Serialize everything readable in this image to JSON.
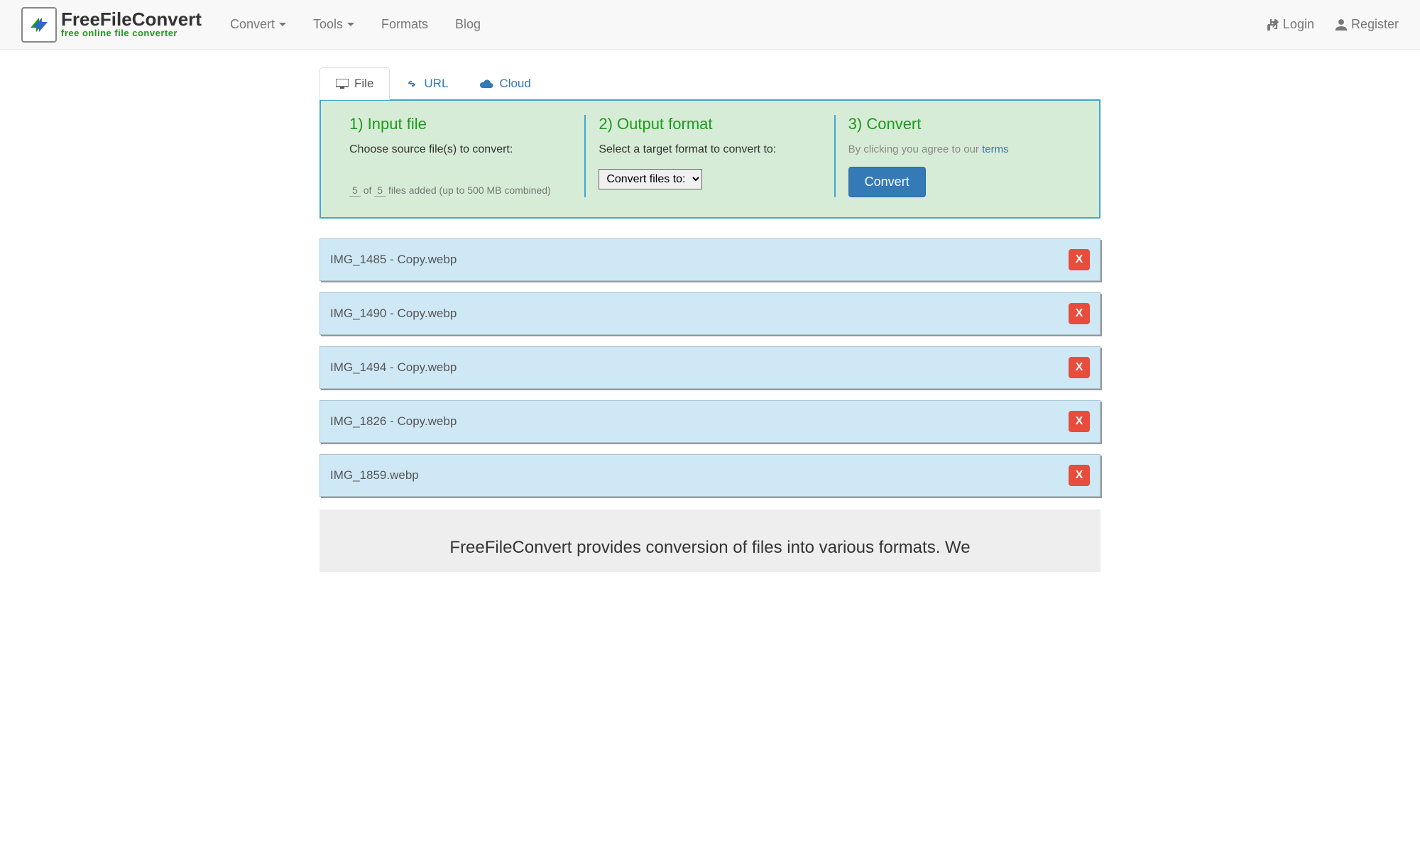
{
  "brand": {
    "name": "FreeFileConvert",
    "tagline": "free online file converter"
  },
  "nav": {
    "convert": "Convert",
    "tools": "Tools",
    "formats": "Formats",
    "blog": "Blog",
    "login": "Login",
    "register": "Register"
  },
  "tabs": {
    "file": "File",
    "url": "URL",
    "cloud": "Cloud"
  },
  "steps": {
    "input": {
      "title": "1) Input file",
      "subtitle": "Choose source file(s) to convert:",
      "count_current": "5",
      "count_max": "5",
      "of_word": "of",
      "count_suffix": "files added (up to 500 MB combined)"
    },
    "output": {
      "title": "2) Output format",
      "subtitle": "Select a target format to convert to:",
      "select_label": "Convert files to:"
    },
    "convert": {
      "title": "3) Convert",
      "terms_prefix": "By clicking you agree to our ",
      "terms_link": "terms",
      "button": "Convert"
    }
  },
  "files": [
    {
      "name": "IMG_1485 - Copy.webp"
    },
    {
      "name": "IMG_1490 - Copy.webp"
    },
    {
      "name": "IMG_1494 - Copy.webp"
    },
    {
      "name": "IMG_1826 - Copy.webp"
    },
    {
      "name": "IMG_1859.webp"
    }
  ],
  "remove_label": "X",
  "description": "FreeFileConvert provides conversion of files into various formats. We"
}
